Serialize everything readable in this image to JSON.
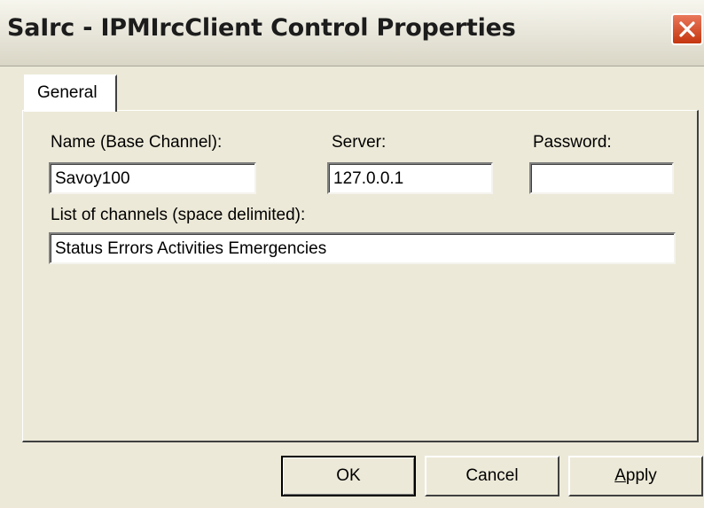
{
  "window": {
    "title": "SaIrc - IPMIrcClient Control Properties"
  },
  "tabs": [
    {
      "label": "General",
      "selected": true
    }
  ],
  "form": {
    "name_label": "Name (Base Channel):",
    "name_value": "Savoy100",
    "server_label": "Server:",
    "server_value": "127.0.0.1",
    "password_label": "Password:",
    "password_value": "",
    "channels_label": "List of channels (space delimited):",
    "channels_value": "Status Errors Activities Emergencies"
  },
  "buttons": {
    "ok": "OK",
    "cancel": "Cancel",
    "apply_access_key": "A",
    "apply_rest": "pply"
  },
  "icons": {
    "close": "close-icon"
  },
  "colors": {
    "face": "#ece9d8",
    "close_button": "#c4360f"
  }
}
